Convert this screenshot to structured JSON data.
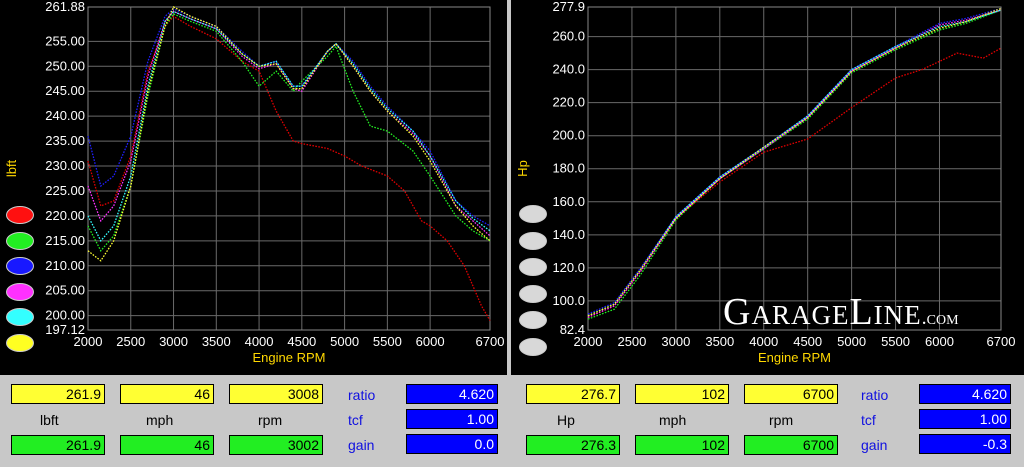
{
  "chart_data": [
    {
      "type": "line",
      "ylabel": "lbft",
      "xlabel": "Engine RPM",
      "xlim": [
        2000,
        6700
      ],
      "ylim": [
        197.12,
        261.88
      ],
      "x_ticks": [
        "2000",
        "2500",
        "3000",
        "3500",
        "4000",
        "4500",
        "5000",
        "5500",
        "6000",
        "6700"
      ],
      "y_ticks": [
        "261.88",
        "255.00",
        "250.00",
        "245.00",
        "240.00",
        "235.00",
        "230.00",
        "225.00",
        "220.00",
        "215.00",
        "210.00",
        "205.00",
        "200.00",
        "197.12"
      ],
      "grid": true,
      "series": [
        {
          "color": "#e00000",
          "x": [
            2000,
            2150,
            2300,
            2500,
            2700,
            2900,
            3000,
            3200,
            3500,
            3800,
            4000,
            4200,
            4400,
            4500,
            4800,
            5000,
            5200,
            5500,
            5700,
            5900,
            6000,
            6200,
            6400,
            6600,
            6700
          ],
          "y": [
            231,
            222,
            223,
            232,
            249,
            258,
            260,
            258,
            255.5,
            251,
            249,
            241,
            235,
            234.5,
            233.5,
            232,
            230,
            228,
            225,
            219,
            218,
            215,
            210,
            202,
            199
          ]
        },
        {
          "color": "#22ee22",
          "x": [
            2000,
            2150,
            2300,
            2500,
            2700,
            2900,
            3000,
            3200,
            3500,
            3800,
            4000,
            4200,
            4400,
            4500,
            4800,
            4900,
            5100,
            5300,
            5500,
            5800,
            6000,
            6300,
            6500,
            6700
          ],
          "y": [
            218,
            213,
            216,
            226,
            244,
            258,
            260.5,
            259,
            257,
            251,
            246,
            249,
            245,
            247,
            252,
            254,
            245,
            238,
            237,
            233,
            228,
            220,
            217,
            215
          ]
        },
        {
          "color": "#2020ff",
          "x": [
            2000,
            2150,
            2300,
            2500,
            2700,
            2900,
            3000,
            3200,
            3500,
            3800,
            4000,
            4200,
            4400,
            4500,
            4800,
            4900,
            5100,
            5300,
            5500,
            5800,
            6000,
            6300,
            6500,
            6700
          ],
          "y": [
            236,
            226,
            228,
            236,
            251,
            260,
            261.5,
            260,
            258,
            253,
            250,
            251,
            246,
            246,
            253,
            254.5,
            251,
            246,
            242,
            237,
            233,
            223,
            220,
            218
          ]
        },
        {
          "color": "#ff30ff",
          "x": [
            2000,
            2150,
            2300,
            2500,
            2700,
            2900,
            3000,
            3200,
            3500,
            3800,
            4000,
            4200,
            4400,
            4500,
            4800,
            4900,
            5100,
            5300,
            5500,
            5800,
            6000,
            6300,
            6500,
            6700
          ],
          "y": [
            226,
            219,
            222,
            231,
            248,
            259,
            261,
            259.5,
            257.5,
            252,
            249.5,
            250.5,
            245.5,
            245,
            253,
            254.5,
            250,
            245,
            241,
            236.5,
            232,
            222,
            219,
            216
          ]
        },
        {
          "color": "#33ffff",
          "x": [
            2000,
            2150,
            2300,
            2500,
            2700,
            2900,
            3000,
            3200,
            3500,
            3800,
            4000,
            4200,
            4400,
            4500,
            4800,
            4900,
            5100,
            5300,
            5500,
            5800,
            6000,
            6300,
            6500,
            6700
          ],
          "y": [
            220,
            215,
            218,
            228,
            246,
            259,
            261,
            259.5,
            257.5,
            252.5,
            250,
            251,
            246,
            246,
            253,
            254.5,
            250.5,
            245.5,
            241.5,
            237,
            232,
            223,
            219.5,
            217
          ]
        },
        {
          "color": "#ffff33",
          "x": [
            2000,
            2150,
            2300,
            2500,
            2700,
            2900,
            3000,
            3200,
            3500,
            3800,
            4000,
            4200,
            4400,
            4500,
            4800,
            4900,
            5100,
            5300,
            5500,
            5800,
            6000,
            6300,
            6500,
            6700
          ],
          "y": [
            213,
            211,
            215,
            226,
            245,
            258,
            261.9,
            260,
            258,
            252.5,
            250,
            250.5,
            245.5,
            245.5,
            253,
            254.5,
            250,
            245,
            241,
            236,
            231,
            222,
            218,
            215
          ]
        }
      ]
    },
    {
      "type": "line",
      "ylabel": "Hp",
      "xlabel": "Engine RPM",
      "xlim": [
        2000,
        6700
      ],
      "ylim": [
        82.4,
        277.9
      ],
      "x_ticks": [
        "2000",
        "2500",
        "3000",
        "3500",
        "4000",
        "4500",
        "5000",
        "5500",
        "6000",
        "6700"
      ],
      "y_ticks": [
        "277.9",
        "260.0",
        "240.0",
        "220.0",
        "200.0",
        "180.0",
        "160.0",
        "140.0",
        "120.0",
        "100.0",
        "82.4"
      ],
      "grid": true,
      "series": [
        {
          "color": "#e00000",
          "x": [
            2000,
            2300,
            2600,
            3000,
            3500,
            4000,
            4500,
            5000,
            5500,
            5800,
            6000,
            6200,
            6500,
            6700
          ],
          "y": [
            90,
            97,
            118,
            150,
            172,
            190,
            198,
            217,
            235,
            240,
            245,
            250,
            247,
            253
          ]
        },
        {
          "color": "#22ee22",
          "x": [
            2000,
            2300,
            2600,
            3000,
            3500,
            4000,
            4500,
            5000,
            5500,
            6000,
            6300,
            6700
          ],
          "y": [
            89,
            95,
            116,
            149,
            174,
            192,
            210,
            238,
            252,
            264,
            268,
            276
          ]
        },
        {
          "color": "#2020ff",
          "x": [
            2000,
            2300,
            2600,
            3000,
            3500,
            4000,
            4500,
            5000,
            5500,
            6000,
            6300,
            6700
          ],
          "y": [
            92,
            99,
            120,
            151,
            175,
            193,
            212,
            240,
            254,
            268,
            271,
            277
          ]
        },
        {
          "color": "#ff30ff",
          "x": [
            2000,
            2300,
            2600,
            3000,
            3500,
            4000,
            4500,
            5000,
            5500,
            6000,
            6300,
            6700
          ],
          "y": [
            90,
            97,
            118,
            150,
            174,
            192,
            211,
            239,
            253,
            267,
            270,
            276
          ]
        },
        {
          "color": "#33ffff",
          "x": [
            2000,
            2300,
            2600,
            3000,
            3500,
            4000,
            4500,
            5000,
            5500,
            6000,
            6300,
            6700
          ],
          "y": [
            91,
            98,
            119,
            151,
            175,
            193,
            212,
            240,
            254,
            266,
            269,
            276
          ]
        },
        {
          "color": "#ffff33",
          "x": [
            2000,
            2300,
            2600,
            3000,
            3500,
            4000,
            4500,
            5000,
            5500,
            6000,
            6300,
            6700
          ],
          "y": [
            91,
            98,
            119,
            150,
            174,
            193,
            211,
            239,
            253,
            265,
            269,
            277
          ]
        }
      ]
    }
  ],
  "legend_swatches": {
    "left": [
      "#ff1010",
      "#22ee22",
      "#1818ff",
      "#ff30ff",
      "#33ffff",
      "#ffff22"
    ],
    "right": [
      "#d8d8d8",
      "#d8d8d8",
      "#d8d8d8",
      "#d8d8d8",
      "#d8d8d8",
      "#d8d8d8"
    ]
  },
  "brand": {
    "main": "GarageLine",
    "suffix": ".com"
  },
  "left_readout": {
    "top": [
      "261.9",
      "46",
      "3008"
    ],
    "labels": [
      "lbft",
      "mph",
      "rpm"
    ],
    "bottom": [
      "261.9",
      "46",
      "3002"
    ],
    "params": [
      {
        "label": "ratio",
        "value": "4.620"
      },
      {
        "label": "tcf",
        "value": "1.00"
      },
      {
        "label": "gain",
        "value": "0.0"
      }
    ]
  },
  "right_readout": {
    "top": [
      "276.7",
      "102",
      "6700"
    ],
    "labels": [
      "Hp",
      "mph",
      "rpm"
    ],
    "bottom": [
      "276.3",
      "102",
      "6700"
    ],
    "params": [
      {
        "label": "ratio",
        "value": "4.620"
      },
      {
        "label": "tcf",
        "value": "1.00"
      },
      {
        "label": "gain",
        "value": "-0.3"
      }
    ]
  }
}
